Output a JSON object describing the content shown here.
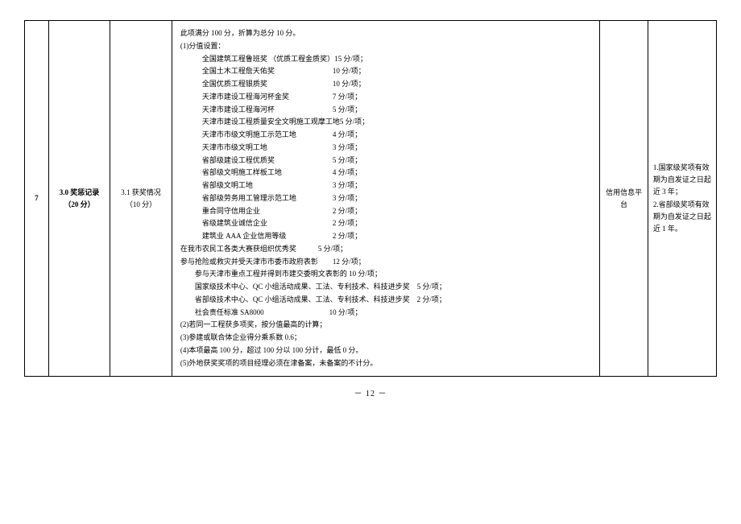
{
  "row": {
    "no": "7",
    "category": "3.0 奖惩记录（20 分）",
    "sub": "3.1 获奖情况（10 分）",
    "source": "信用信息平台",
    "notes": "1.国家级奖项有效期为自发证之日起近 3 年；\n2.省部级奖项有效期为自发证之日起近 1 年。"
  },
  "content": {
    "header": "此项满分 100 分，折算为总分 10 分。",
    "section1_title": "(1)分值设置：",
    "awards": [
      {
        "name": "全国建筑工程鲁班奖 （优质工程金质奖）",
        "score": "15 分/项；"
      },
      {
        "name": "全国土木工程詹天佑奖",
        "score": "10 分/项；"
      },
      {
        "name": "全国优质工程银质奖",
        "score": "10 分/项；"
      },
      {
        "name": "天津市建设工程海河杯金奖",
        "score": "7 分/项；"
      },
      {
        "name": "天津市建设工程海河杯",
        "score": "5 分/项；"
      },
      {
        "name": "天津市建设工程质量安全文明施工观摩工地",
        "score": "5 分/项；"
      },
      {
        "name": "天津市市级文明施工示范工地",
        "score": "4 分/项；"
      },
      {
        "name": "天津市市级文明工地",
        "score": "3 分/项；"
      },
      {
        "name": "省部级建设工程优质奖",
        "score": "5 分/项；"
      },
      {
        "name": "省部级文明施工样板工地",
        "score": "4 分/项；"
      },
      {
        "name": "省部级文明工地",
        "score": "3 分/项；"
      },
      {
        "name": "省部级劳务用工管理示范工地",
        "score": "3 分/项；"
      },
      {
        "name": "重合同守信用企业",
        "score": "2 分/项；"
      },
      {
        "name": "省级建筑业诚信企业",
        "score": "2 分/项；"
      },
      {
        "name": "建筑业 AAA 企业信用等级",
        "score": "2 分/项；"
      }
    ],
    "extra_lines": [
      "在我市农民工各类大赛获组织优秀奖　　　5 分/项；",
      "参与抢险或救灾并受天津市市委市政府表彰　　12 分/项；",
      "　　参与天津市重点工程并得到市建交委明文表彰的 10 分/项；",
      "　　国家级技术中心、QC 小组活动成果、工法、专利技术、科技进步奖　5 分/项；",
      "　　省部级技术中心、QC 小组活动成果、工法、专利技术、科技进步奖　2 分/项；",
      "　　社会责任标准 SA8000　　　　　　　　　10 分/项；"
    ],
    "rules": [
      "(2)若同一工程获多项奖，按分值最高的计算；",
      "(3)参建或联合体企业得分乘系数 0.6；",
      "(4)本项最高 100 分，超过 100 分以 100 分计，最低 0 分。",
      "(5)外地获奖奖项的项目经理必须在津备案，未备案的不计分。"
    ]
  },
  "page": "－ 12 －"
}
